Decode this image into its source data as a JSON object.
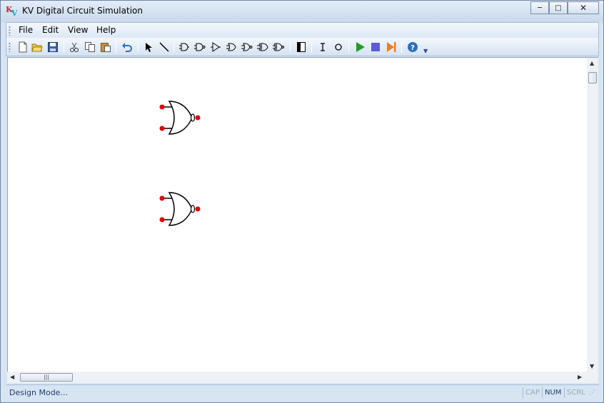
{
  "window": {
    "title": "KV Digital Circuit Simulation",
    "icon": "kv-logo-icon",
    "controls": [
      "minimize",
      "maximize",
      "close"
    ]
  },
  "menu": {
    "items": [
      {
        "label": "File"
      },
      {
        "label": "Edit"
      },
      {
        "label": "View"
      },
      {
        "label": "Help"
      }
    ]
  },
  "toolbar": {
    "buttons": [
      "new-icon",
      "open-icon",
      "save-icon",
      "cut-icon",
      "copy-icon",
      "paste-icon",
      "undo-icon",
      "select-pointer-icon",
      "wire-icon",
      "and-gate-icon",
      "nand-gate-icon",
      "buffer-gate-icon",
      "or-gate-icon",
      "nor-gate-icon",
      "xor-gate-icon",
      "xnor-gate-icon",
      "switch-icon",
      "input-pin-icon",
      "output-pin-icon",
      "run-icon",
      "stop-icon",
      "step-icon",
      "help-icon"
    ],
    "colors": {
      "run": "#1e9e2a",
      "stop": "#5b5bd6",
      "step": "#f07f1a",
      "help": "#2a6fc2"
    }
  },
  "canvas": {
    "components": [
      {
        "type": "nor-gate"
      },
      {
        "type": "nor-gate"
      }
    ],
    "pin_color": "#e00000"
  },
  "statusbar": {
    "text": "Design Mode...",
    "indicators": [
      {
        "label": "CAP",
        "active": false
      },
      {
        "label": "NUM",
        "active": true
      },
      {
        "label": "SCRL",
        "active": false
      }
    ]
  }
}
